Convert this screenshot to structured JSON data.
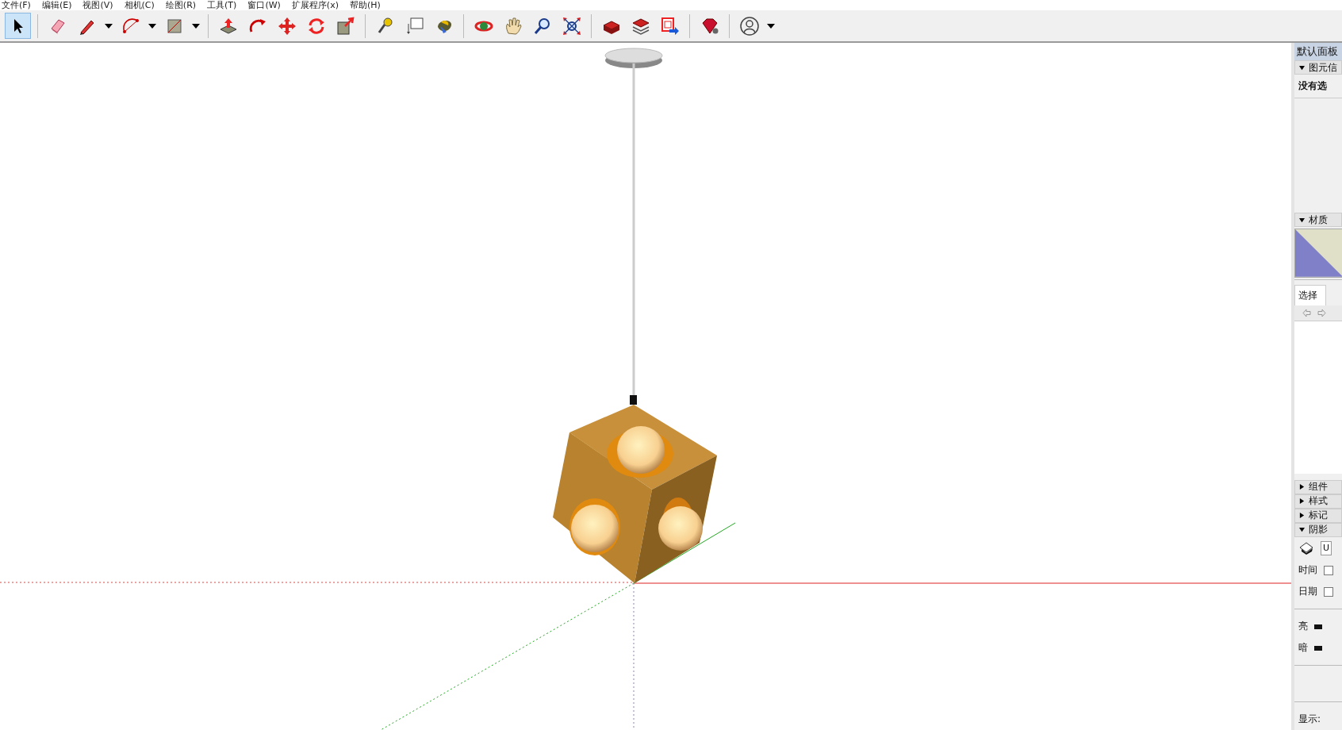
{
  "menu": [
    "文件(F)",
    "编辑(E)",
    "视图(V)",
    "相机(C)",
    "绘图(R)",
    "工具(T)",
    "窗口(W)",
    "扩展程序(x)",
    "帮助(H)"
  ],
  "toolbar": [
    {
      "kind": "select",
      "selected": true
    },
    {
      "kind": "eraser",
      "selected": false,
      "sep": true
    },
    {
      "kind": "pencil",
      "selected": false,
      "menu": true
    },
    {
      "kind": "arc",
      "selected": false,
      "menu": true
    },
    {
      "kind": "rectangle",
      "selected": false,
      "menu": true
    },
    {
      "kind": "pushpull",
      "selected": false,
      "sep": true
    },
    {
      "kind": "followme",
      "selected": false
    },
    {
      "kind": "move",
      "selected": false
    },
    {
      "kind": "rotate",
      "selected": false
    },
    {
      "kind": "scale",
      "selected": false
    },
    {
      "kind": "tape",
      "selected": false,
      "sep": true
    },
    {
      "kind": "text",
      "selected": false
    },
    {
      "kind": "paint",
      "selected": false
    },
    {
      "kind": "orbit",
      "selected": false,
      "sep": true
    },
    {
      "kind": "pan",
      "selected": false
    },
    {
      "kind": "zoom",
      "selected": false
    },
    {
      "kind": "extents",
      "selected": false
    },
    {
      "kind": "warehouse",
      "selected": false,
      "sep": true
    },
    {
      "kind": "share",
      "selected": false
    },
    {
      "kind": "export",
      "selected": false
    },
    {
      "kind": "ruby",
      "selected": false,
      "sep": true
    },
    {
      "kind": "account",
      "selected": false,
      "sep": true,
      "menu": true
    }
  ],
  "tray": {
    "title": "默认面板",
    "entity_info": {
      "title": "图元信",
      "expanded": true,
      "status": "没有选"
    },
    "materials": {
      "title": "材质",
      "expanded": true,
      "tab": "选择"
    },
    "collapsed": [
      {
        "title": "组件",
        "expanded": false
      },
      {
        "title": "样式",
        "expanded": false
      },
      {
        "title": "标记",
        "expanded": false
      }
    ],
    "shadows": {
      "title": "阴影",
      "expanded": true,
      "timezone": "U",
      "rows": [
        {
          "kind": "check",
          "label": "时间",
          "checked": false
        },
        {
          "kind": "check",
          "label": "日期",
          "checked": false
        },
        {
          "kind": "slider",
          "label": "亮"
        },
        {
          "kind": "slider",
          "label": "暗"
        }
      ],
      "display": "显示:"
    }
  }
}
